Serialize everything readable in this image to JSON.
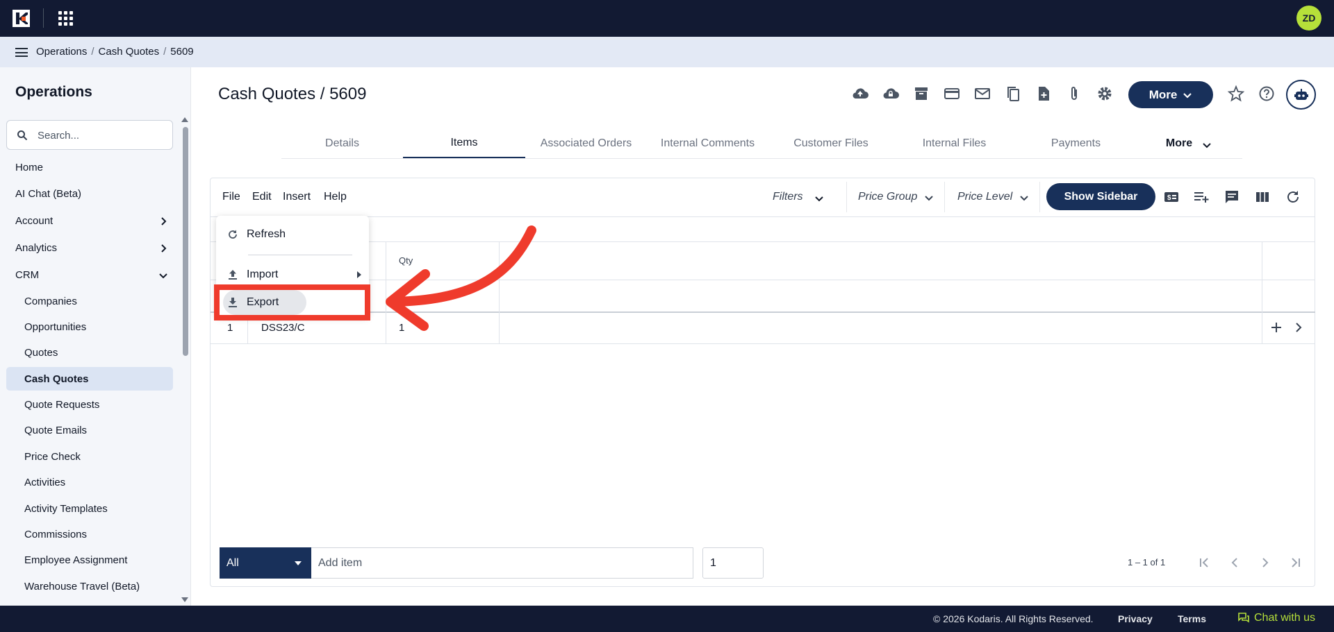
{
  "header": {
    "avatar_initials": "ZD",
    "brand_color": "#121a33",
    "accent_color": "#18305a"
  },
  "breadcrumb": [
    "Operations",
    "Cash Quotes",
    "5609"
  ],
  "sidebar": {
    "title": "Operations",
    "search_placeholder": "Search...",
    "items": [
      {
        "label": "Home"
      },
      {
        "label": "AI Chat (Beta)"
      },
      {
        "label": "Account",
        "icon": "chevron-right-icon"
      },
      {
        "label": "Analytics",
        "icon": "chevron-right-icon"
      },
      {
        "label": "CRM",
        "icon": "chevron-down-icon"
      }
    ],
    "crm_items": [
      "Companies",
      "Opportunities",
      "Quotes",
      "Cash Quotes",
      "Quote Requests",
      "Quote Emails",
      "Price Check",
      "Activities",
      "Activity Templates",
      "Commissions",
      "Employee Assignment",
      "Warehouse Travel (Beta)"
    ],
    "active_item": "Cash Quotes"
  },
  "main": {
    "title": "Cash Quotes / 5609",
    "more_label": "More",
    "toolbar_icons": [
      "cloud-upload-icon",
      "cloud-lock-icon",
      "archive-icon",
      "credit-card-icon",
      "mail-icon",
      "copy-icon",
      "file-add-icon",
      "attachment-icon",
      "gear-icon"
    ],
    "tabs": [
      "Details",
      "Items",
      "Associated Orders",
      "Internal Comments",
      "Customer Files",
      "Internal Files",
      "Payments",
      "More"
    ],
    "active_tab": "Items"
  },
  "sheet": {
    "menus": [
      "File",
      "Edit",
      "Insert",
      "Help"
    ],
    "filters_label": "Filters",
    "price_group_label": "Price Group",
    "price_level_label": "Price Level",
    "show_sidebar_label": "Show Sidebar",
    "columns": {
      "qty": "Qty"
    },
    "rows": [
      {
        "num": "1",
        "item": "DSS23/C",
        "qty": "1"
      }
    ],
    "file_menu": {
      "refresh": "Refresh",
      "import": "Import",
      "export": "Export"
    },
    "bottom": {
      "filter_value": "All",
      "add_item_placeholder": "Add item",
      "quantity": "1",
      "pager": "1 – 1 of 1"
    }
  },
  "footer": {
    "copyright": "© 2026 Kodaris. All Rights Reserved.",
    "privacy": "Privacy",
    "terms": "Terms",
    "chat": "Chat with us"
  }
}
